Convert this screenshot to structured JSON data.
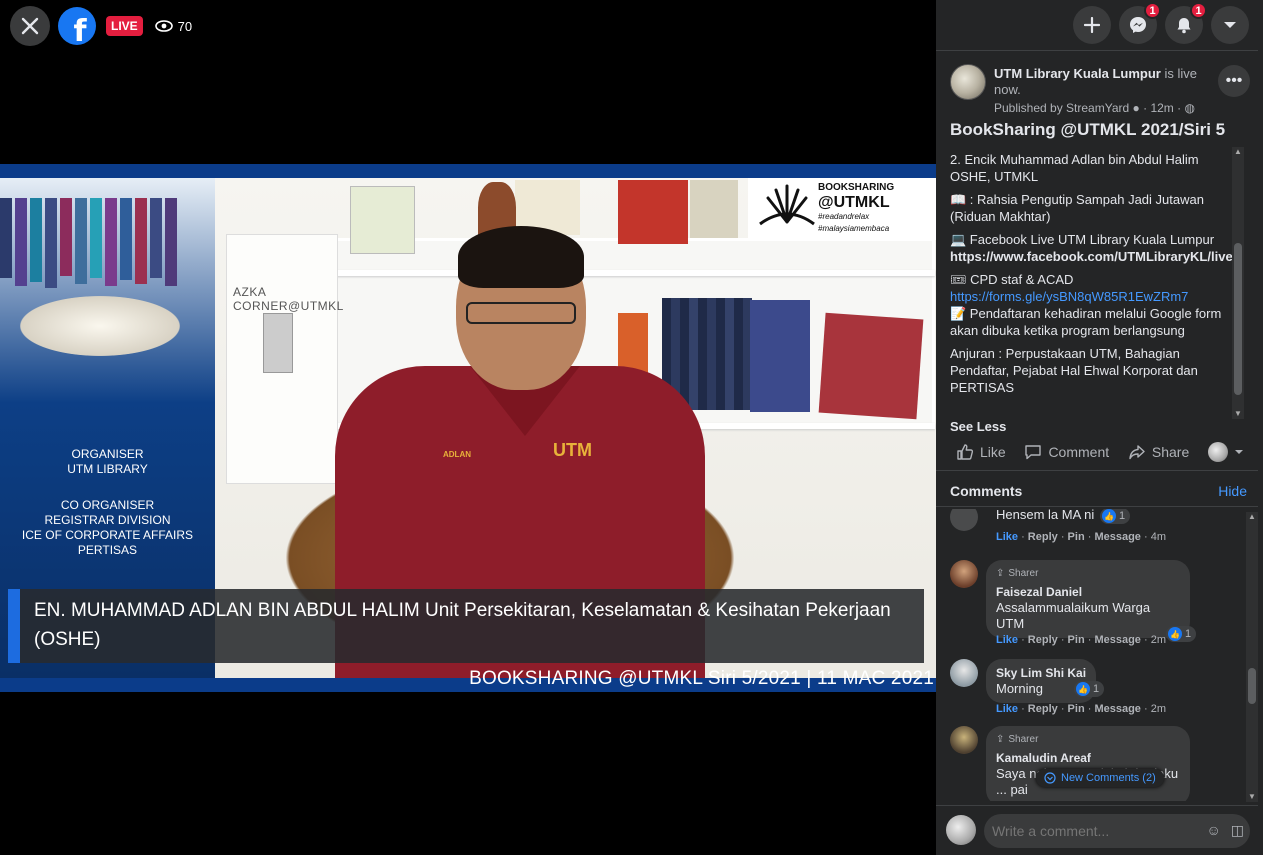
{
  "topbar": {
    "live_label": "LIVE",
    "viewer_count": "70"
  },
  "header": {
    "messenger_badge": "1",
    "notifications_badge": "1"
  },
  "video": {
    "caption": "EN. MUHAMMAD ADLAN BIN ABDUL HALIM Unit Persekitaran, Keselamatan & Kesihatan Pekerjaan (OSHE)",
    "footer": "BOOKSHARING @UTMKL Siri 5/2021 | 11 MAC 2021",
    "banner_organiser_label": "ORGANISER",
    "banner_organiser": "UTM LIBRARY",
    "banner_co_label": "CO ORGANISER",
    "banner_co_1": "REGISTRAR DIVISION",
    "banner_co_2": "ICE OF CORPORATE AFFAIRS",
    "banner_co_3": "PERTISAS",
    "azka_label": "AZKA CORNER@UTMKL",
    "logo_line1": "BOOKSHARING",
    "logo_line2": "@UTMKL",
    "logo_tag1": "#readandrelax",
    "logo_tag2": "#malaysiamembaca",
    "badge_utm": "UTM",
    "badge_name": "ADLAN"
  },
  "post": {
    "author": "UTM Library Kuala Lumpur",
    "status": " is live now.",
    "meta": "Published by StreamYard",
    "time": "12m",
    "title": "BookSharing @UTMKL 2021/Siri 5",
    "body": {
      "p1": "2. Encik Muhammad Adlan bin Abdul Halim OSHE, UTMKL",
      "p2": "📖 : Rahsia Pengutip Sampah Jadi Jutawan (Riduan Makhtar)",
      "p3a": "💻 Facebook Live UTM Library Kuala Lumpur",
      "p3b": "https://www.facebook.com/UTMLibraryKL/live",
      "p4a": "🎟 CPD staf & ACAD",
      "p4b": "https://forms.gle/ysBN8qW85R1EwZRm7",
      "p4c": "📝 Pendaftaran kehadiran melalui Google form akan dibuka ketika program berlangsung",
      "p5": "Anjuran : Perpustakaan UTM, Bahagian Pendaftar, Pejabat Hal Ehwal Korporat dan PERTISAS"
    },
    "see_less": "See Less",
    "actions": {
      "like": "Like",
      "comment": "Comment",
      "share": "Share"
    }
  },
  "comments": {
    "header": "Comments",
    "hide": "Hide",
    "items": [
      {
        "name": "",
        "role": "",
        "text": "Hensem la MA ni",
        "reactions": "1",
        "like": "Like",
        "reply": "Reply",
        "pin": "Pin",
        "message": "Message",
        "time": "4m"
      },
      {
        "name": "Faisezal Daniel",
        "role": "Sharer",
        "text": "Assalammualaikum Warga UTM",
        "reactions": "1",
        "like": "Like",
        "reply": "Reply",
        "pin": "Pin",
        "message": "Message",
        "time": "2m"
      },
      {
        "name": "Sky Lim Shi Kai",
        "role": "",
        "text": "Morning",
        "reactions": "1",
        "like": "Like",
        "reply": "Reply",
        "pin": "Pin",
        "message": "Message",
        "time": "2m"
      },
      {
        "name": "Kamaludin Areaf",
        "role": "Sharer",
        "text": "Saya nak tanya adakah berlaku ... pai ",
        "like": "",
        "reply": "",
        "pin": "",
        "message": "",
        "time": ""
      }
    ],
    "new_comments": "New Comments (2)"
  },
  "composer": {
    "placeholder": "Write a comment..."
  },
  "colors": {
    "accent": "#1877f2",
    "live": "#e41e3f",
    "link": "#4599ff",
    "panel": "#242526"
  }
}
